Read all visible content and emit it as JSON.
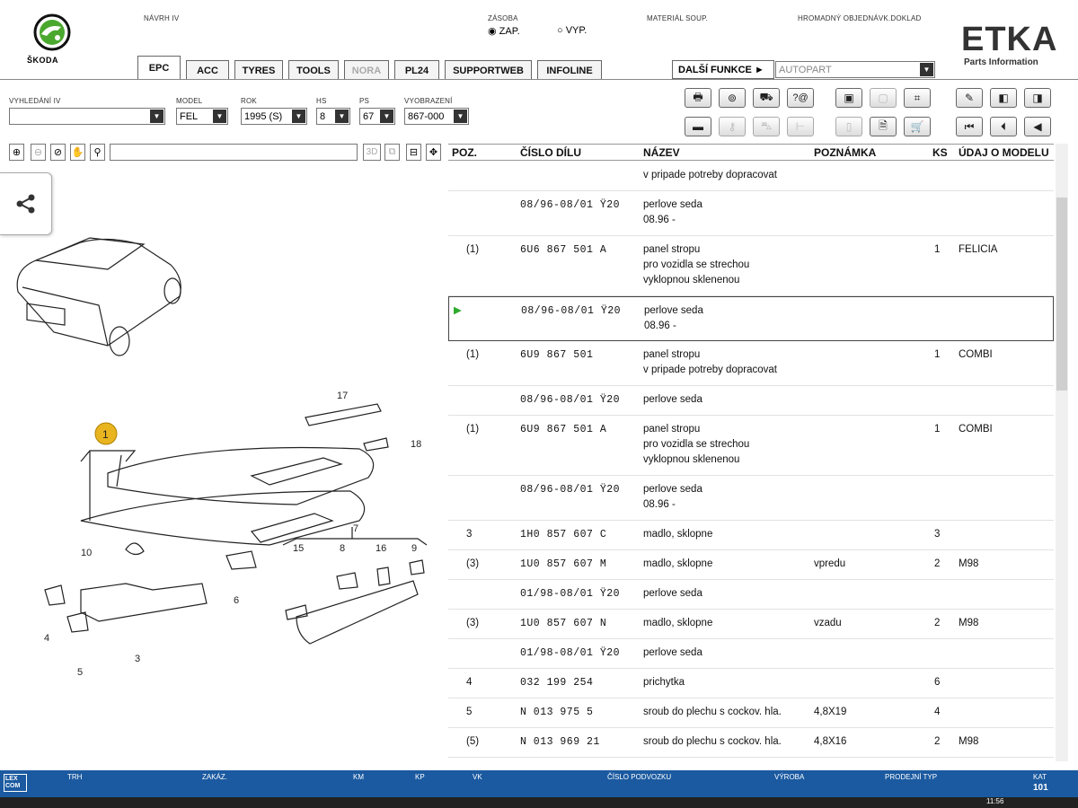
{
  "header": {
    "brand": "ŠKODA",
    "navrh_label": "NÁVRH IV",
    "zasoba_label": "ZÁSOBA",
    "zap": "ZAP.",
    "vyp": "VYP.",
    "material_label": "MATERIÁL SOUP.",
    "hromadny_label": "HROMADNÝ OBJEDNÁVK.DOKLAD",
    "etka": "ETKA",
    "etka_sub": "Parts Information"
  },
  "tabs": [
    "EPC",
    "ACC",
    "TYRES",
    "TOOLS",
    "NORA",
    "PL24",
    "SUPPORTWEB",
    "INFOLINE"
  ],
  "dalsi": {
    "label": "DALŠÍ FUNKCE ►",
    "value": "AUTOPART"
  },
  "filters": {
    "vyhledani_label": "VYHLEDÁNÍ IV",
    "vyhledani_value": "",
    "model_label": "MODEL",
    "model_value": "FEL",
    "rok_label": "ROK",
    "rok_value": "1995 (S)",
    "hs_label": "HS",
    "hs_value": "8",
    "ps_label": "PS",
    "ps_value": "67",
    "vyobrazeni_label": "VYOBRAZENÍ",
    "vyobrazeni_value": "867-000"
  },
  "toolbar_icons": [
    "printer-icon",
    "stamp-icon",
    "car-wash-icon",
    "help-icon",
    "basket-icon",
    "disabled-icon",
    "filter-icon",
    "pin-icon",
    "prev-page-icon",
    "next-page-icon",
    "screen-icon",
    "key-icon",
    "car-outline-icon",
    "arrow-icon",
    "phone-icon",
    "document-icon",
    "cart-icon",
    "first-icon",
    "prev-icon",
    "back-icon"
  ],
  "viewer": {
    "zoom_labels": [
      "3D"
    ]
  },
  "grid": {
    "columns": [
      "POZ.",
      "ČÍSLO DÍLU",
      "NÁZEV",
      "POZNÁMKA",
      "KS",
      "ÚDAJ O MODELU"
    ],
    "rows": [
      {
        "poz": "",
        "cislo": "",
        "nazev": [
          "v pripade potreby dopracovat"
        ],
        "pozn": "",
        "ks": "",
        "model": ""
      },
      {
        "poz": "",
        "cislo": "08/96-08/01 Ÿ20",
        "nazev": [
          "perlove seda",
          "08.96 -"
        ],
        "pozn": "",
        "ks": "",
        "model": ""
      },
      {
        "poz": "(1)",
        "cislo": "6U6 867 501 A",
        "nazev": [
          "panel stropu",
          "pro vozidla se strechou",
          "vyklopnou sklenenou"
        ],
        "pozn": "",
        "ks": "1",
        "model": "FELICIA"
      },
      {
        "poz": "",
        "cislo": "08/96-08/01 Ÿ20",
        "nazev": [
          "perlove seda",
          "08.96 -"
        ],
        "pozn": "",
        "ks": "",
        "model": "",
        "selected": true
      },
      {
        "poz": "(1)",
        "cislo": "6U9 867 501",
        "nazev": [
          "panel stropu",
          "v pripade potreby dopracovat"
        ],
        "pozn": "",
        "ks": "1",
        "model": "COMBI"
      },
      {
        "poz": "",
        "cislo": "08/96-08/01 Ÿ20",
        "nazev": [
          "perlove seda"
        ],
        "pozn": "",
        "ks": "",
        "model": ""
      },
      {
        "poz": "(1)",
        "cislo": "6U9 867 501 A",
        "nazev": [
          "panel stropu",
          "pro vozidla se strechou",
          "vyklopnou sklenenou"
        ],
        "pozn": "",
        "ks": "1",
        "model": "COMBI"
      },
      {
        "poz": "",
        "cislo": "08/96-08/01 Ÿ20",
        "nazev": [
          "perlove seda",
          "08.96 -"
        ],
        "pozn": "",
        "ks": "",
        "model": ""
      },
      {
        "poz": "3",
        "cislo": "1H0 857 607 C",
        "nazev": [
          "madlo, sklopne"
        ],
        "pozn": "",
        "ks": "3",
        "model": ""
      },
      {
        "poz": "(3)",
        "cislo": "1U0 857 607 M",
        "nazev": [
          "madlo, sklopne"
        ],
        "pozn": "vpredu",
        "ks": "2",
        "model": "M98"
      },
      {
        "poz": "",
        "cislo": "01/98-08/01 Ÿ20",
        "nazev": [
          "perlove seda"
        ],
        "pozn": "",
        "ks": "",
        "model": ""
      },
      {
        "poz": "(3)",
        "cislo": "1U0 857 607 N",
        "nazev": [
          "madlo, sklopne"
        ],
        "pozn": "vzadu",
        "ks": "2",
        "model": "M98"
      },
      {
        "poz": "",
        "cislo": "01/98-08/01 Ÿ20",
        "nazev": [
          "perlove seda"
        ],
        "pozn": "",
        "ks": "",
        "model": ""
      },
      {
        "poz": "4",
        "cislo": "032 199 254",
        "nazev": [
          "prichytka"
        ],
        "pozn": "",
        "ks": "6",
        "model": ""
      },
      {
        "poz": "5",
        "cislo": "N    013 975 5",
        "nazev": [
          "sroub do plechu s cockov. hla."
        ],
        "pozn": "4,8X19",
        "ks": "4",
        "model": ""
      },
      {
        "poz": "(5)",
        "cislo": "N    013 969 21",
        "nazev": [
          "sroub do plechu s cockov. hla."
        ],
        "pozn": "4,8X16",
        "ks": "2",
        "model": "M98"
      }
    ]
  },
  "diagram": {
    "labels": [
      "17",
      "18",
      "1",
      "10",
      "6",
      "7",
      "15",
      "8",
      "16",
      "9",
      "4",
      "5",
      "3"
    ]
  },
  "status": {
    "labels": [
      "TRH",
      "ZAKÁZ.",
      "KM",
      "KP",
      "VK",
      "ČÍSLO PODVOZKU",
      "VÝROBA",
      "PRODEJNÍ TYP",
      "KAT"
    ],
    "kat_value": "101",
    "brand": "LEX COM",
    "clock": "11:56"
  },
  "colors": {
    "status_bar": "#1b5aa0",
    "callout": "#e8b520",
    "skoda_green": "#4ba82e"
  }
}
